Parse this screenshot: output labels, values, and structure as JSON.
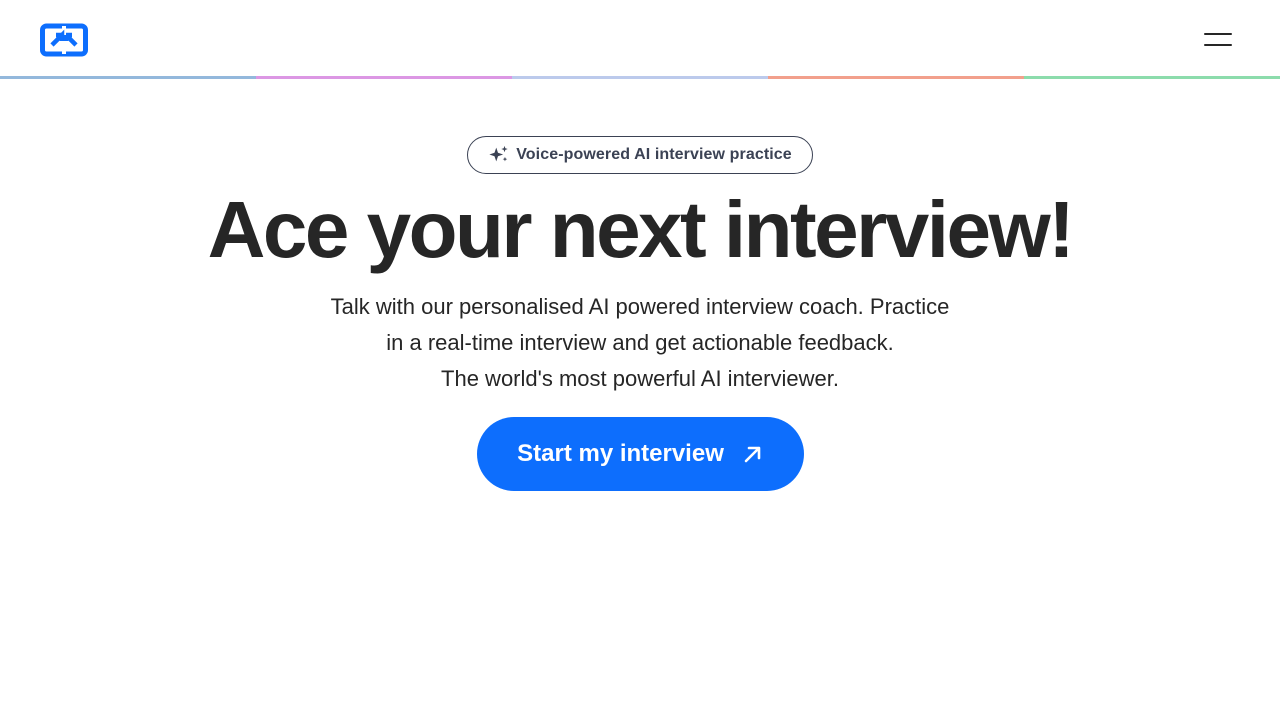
{
  "header": {
    "logo_icon": "app-logo-icon",
    "menu_icon": "hamburger-menu-icon",
    "brand_color": "#0d6efd",
    "stripe_colors": [
      "#93b8dc",
      "#dc97e4",
      "#bccaec",
      "#f2a08c",
      "#8cdcac"
    ]
  },
  "hero": {
    "badge": {
      "icon": "sparkles-icon",
      "text": "Voice-powered AI interview practice"
    },
    "title": "Ace your next interview!",
    "subtitle_lines": [
      "Talk with our personalised AI powered interview coach. Practice",
      "in a real-time interview and get actionable feedback.",
      "The world's most powerful AI interviewer."
    ],
    "cta": {
      "label": "Start my interview",
      "icon": "arrow-up-right-icon",
      "color": "#0d6efd"
    }
  }
}
